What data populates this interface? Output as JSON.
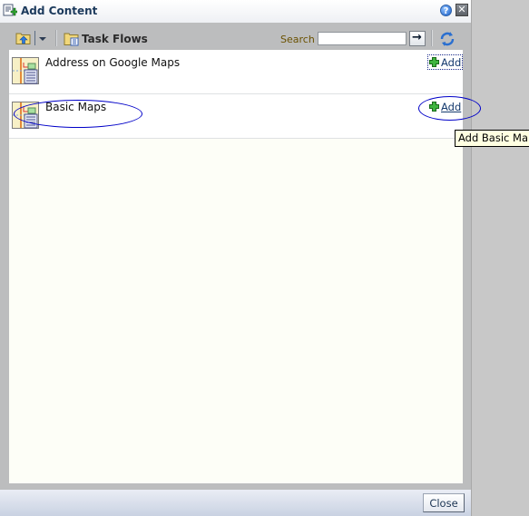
{
  "dialog": {
    "title": "Add Content",
    "help_icon": "help-icon",
    "close_icon": "close-icon"
  },
  "toolbar": {
    "up_folder_icon": "folder-up-icon",
    "dropdown_icon": "chevron-down-icon",
    "breadcrumb_label": "Task Flows",
    "breadcrumb_icon": "taskflow-folder-icon",
    "search_label": "Search",
    "search_value": "",
    "search_placeholder": "",
    "go_icon": "arrow-right-icon",
    "refresh_icon": "refresh-icon"
  },
  "items": [
    {
      "title": "Address on Google Maps",
      "add_label": "Add",
      "icon": "taskflow-icon",
      "focused": true
    },
    {
      "title": "Basic Maps",
      "add_label": "Add",
      "icon": "taskflow-icon",
      "hovered": true
    }
  ],
  "tooltip": {
    "text": "Add Basic Maps"
  },
  "annotations": {
    "color": "#0000c8"
  },
  "footer": {
    "close_label": "Close"
  }
}
